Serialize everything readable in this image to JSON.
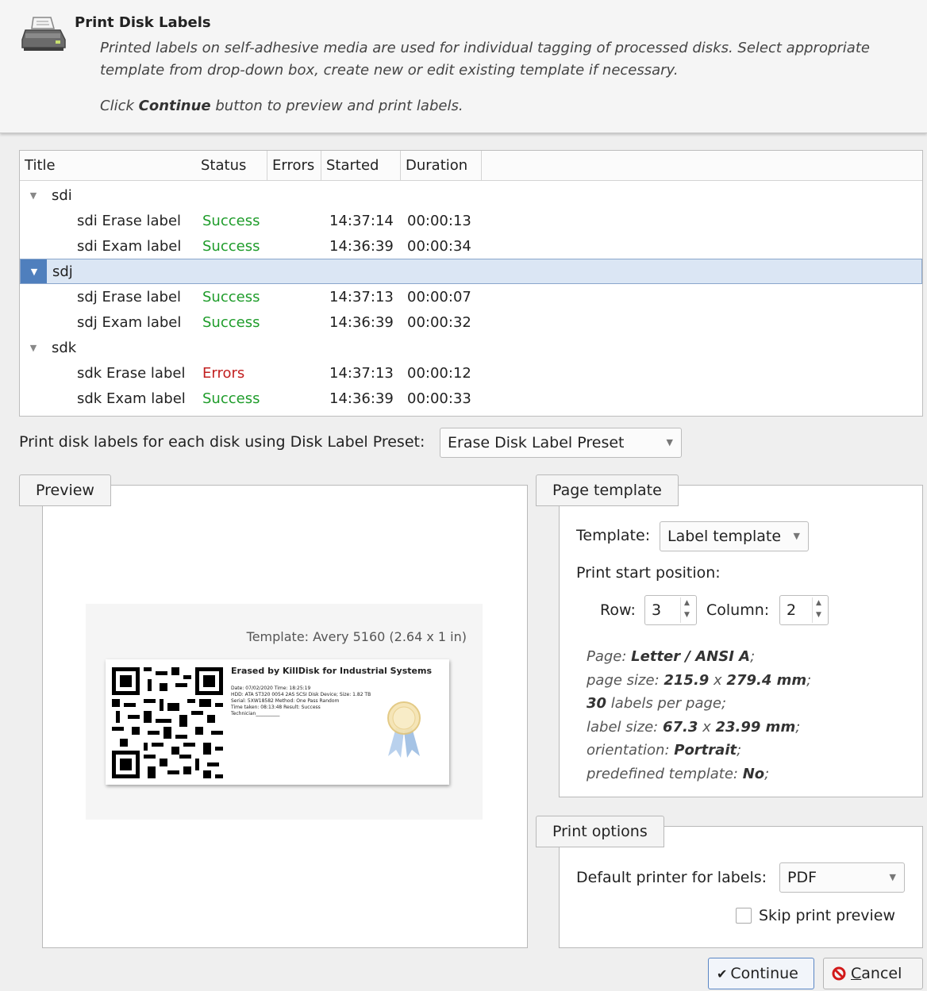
{
  "header": {
    "title": "Print Disk Labels",
    "description": "Printed labels on self-adhesive media are used for individual tagging of processed disks. Select appropriate template from drop-down box, create new or edit existing template if necessary.",
    "hint_prefix": "Click ",
    "hint_bold": "Continue",
    "hint_suffix": " button to preview and print labels."
  },
  "table": {
    "columns": [
      "Title",
      "Status",
      "Errors",
      "Started",
      "Duration"
    ],
    "rows": [
      {
        "type": "group",
        "title": "sdi",
        "selected": false
      },
      {
        "type": "item",
        "title": "sdi Erase label",
        "status": "Success",
        "errors": "",
        "started": "14:37:14",
        "duration": "00:00:13"
      },
      {
        "type": "item",
        "title": "sdi Exam label",
        "status": "Success",
        "errors": "",
        "started": "14:36:39",
        "duration": "00:00:34"
      },
      {
        "type": "group",
        "title": "sdj",
        "selected": true
      },
      {
        "type": "item",
        "title": "sdj Erase label",
        "status": "Success",
        "errors": "",
        "started": "14:37:13",
        "duration": "00:00:07"
      },
      {
        "type": "item",
        "title": "sdj Exam label",
        "status": "Success",
        "errors": "",
        "started": "14:36:39",
        "duration": "00:00:32"
      },
      {
        "type": "group",
        "title": "sdk",
        "selected": false
      },
      {
        "type": "item",
        "title": "sdk Erase label",
        "status": "Errors",
        "errors": "",
        "started": "14:37:13",
        "duration": "00:00:12"
      },
      {
        "type": "item",
        "title": "sdk Exam label",
        "status": "Success",
        "errors": "",
        "started": "14:36:39",
        "duration": "00:00:33"
      }
    ]
  },
  "preset": {
    "label": "Print disk labels for each disk using Disk Label Preset:",
    "value": "Erase Disk Label Preset"
  },
  "preview": {
    "title": "Preview",
    "template_caption": "Template: Avery 5160 (2.64 x 1 in)",
    "label_heading": "Erased by KillDisk for Industrial Systems",
    "label_lines": [
      "Date: 07/02/2020 Time: 18:25:19",
      "HDD: ATA ST320 0054 2AS SCSI Disk Device; Size: 1.82 TB",
      "Serial: 5XW18582 Method: One Pass Random",
      "Time taken: 08:13:48 Result: Success",
      "Technician__________"
    ]
  },
  "page_template": {
    "title": "Page template",
    "template_label": "Template:",
    "template_value": "Label template",
    "start_label": "Print start position:",
    "row_label": "Row:",
    "row_value": "3",
    "column_label": "Column:",
    "column_value": "2",
    "info": {
      "page_label": "Page: ",
      "page_value": "Letter / ANSI A",
      "page_size_label": "page size: ",
      "page_size_w": "215.9",
      "page_size_x": " x ",
      "page_size_h": "279.4 mm",
      "labels_count": "30",
      "labels_suffix": " labels per page;",
      "label_size_label": "label size: ",
      "label_size_w": "67.3",
      "label_size_x": " x ",
      "label_size_h": "23.99 mm",
      "orientation_label": "orientation: ",
      "orientation_value": "Portrait",
      "predefined_label": "predefined template: ",
      "predefined_value": "No"
    }
  },
  "print_options": {
    "title": "Print options",
    "printer_label": "Default printer for labels:",
    "printer_value": "PDF",
    "skip_label": "Skip print preview",
    "skip_checked": false
  },
  "buttons": {
    "continue": "Continue",
    "cancel_underlined": "C",
    "cancel_rest": "ancel"
  },
  "colors": {
    "success": "#1e9c2a",
    "error": "#c22020",
    "selection": "#dbe6f4",
    "selection_accent": "#4f7fbd"
  }
}
